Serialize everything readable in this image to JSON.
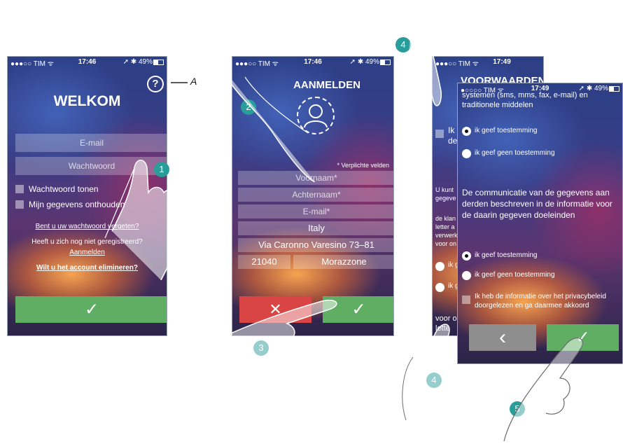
{
  "status": {
    "carrier": "●●●○○ TIM ᯤ",
    "carrier2": "●○○○○ TIM ᯤ",
    "battery": "➚ ✱ 49%",
    "time1": "17:46",
    "time2": "17:46",
    "time3": "17:49",
    "time4": "17:49"
  },
  "callouts": {
    "a_label": "A",
    "step1": "1",
    "step2": "2",
    "step3": "3",
    "step4a": "4",
    "step4b": "4",
    "step5": "5"
  },
  "screen1": {
    "title": "WELKOM",
    "help": "?",
    "email_placeholder": "E-mail",
    "password_placeholder": "Wachtwoord",
    "show_password": "Wachtwoord tonen",
    "remember": "Mijn gegevens onthouden",
    "forgot": "Bent u uw wachtwoord vergeten?",
    "not_registered": "Heeft u zich nog niet geregistreerd?",
    "register_link": "Aanmelden",
    "delete_account": "Wilt u het account elimineren?",
    "confirm": "✓"
  },
  "screen2": {
    "title": "AANMELDEN",
    "required_note": "* Verplichte velden",
    "first_name": "Voornaam*",
    "last_name": "Achternaam*",
    "email": "E-mail*",
    "country": "Italy",
    "address": "Via Caronno Varesino 73–81",
    "zip": "21040",
    "city": "Morazzone",
    "cancel": "✕",
    "confirm": "✓"
  },
  "screen3": {
    "title": "VOORWAARDEN",
    "check_label_1": "Ik",
    "check_label_2": "de",
    "text1": "U kunt",
    "text2": "gegeve",
    "text3": "de klan",
    "text4": "letter a",
    "text5": "verwerk",
    "text6": "voor on",
    "radio1": "ik g",
    "radio2": "ik g",
    "bottom1": "voor o",
    "bottom2": "lette"
  },
  "screen4": {
    "top_text_1": "systemen (sms, mms, fax, e-mail) en",
    "top_text_2": "traditionele middelen",
    "consent_yes_1": "ik geef toestemming",
    "consent_no_1": "ik geef geen toestemming",
    "paragraph": "De communicatie van de gegevens aan derden beschreven in de informatie voor de daarin gegeven doeleinden",
    "consent_yes_2": "ik geef toestemming",
    "consent_no_2": "ik geef geen toestemming",
    "privacy": "Ik heb de informatie over het privacybeleid doorgelezen en ga daarmee akkoord",
    "back": "‹",
    "confirm": "✓"
  }
}
